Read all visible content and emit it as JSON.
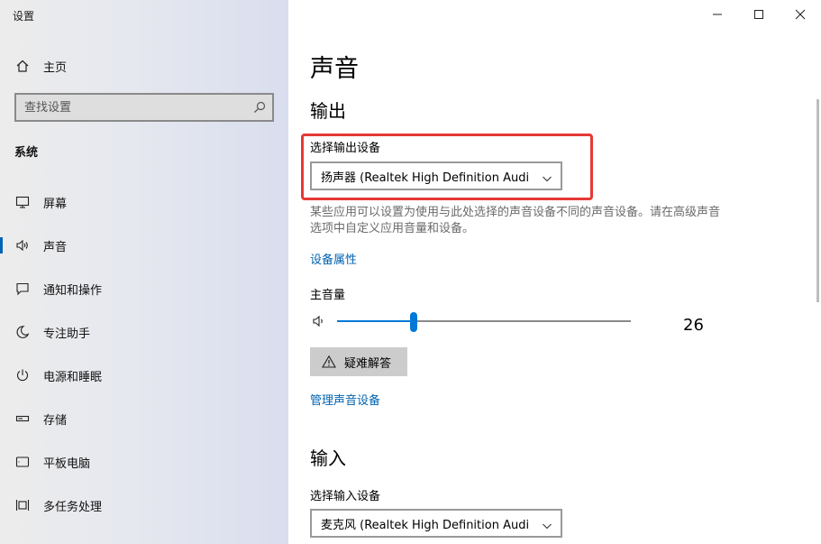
{
  "window": {
    "title": "设置",
    "controls": {
      "minimize": "minimize-icon",
      "maximize": "maximize-icon",
      "close": "close-icon"
    }
  },
  "sidebar": {
    "home_label": "主页",
    "search_placeholder": "查找设置",
    "section_label": "系统",
    "items": [
      {
        "label": "屏幕",
        "icon": "monitor-icon"
      },
      {
        "label": "声音",
        "icon": "speaker-icon",
        "selected": true
      },
      {
        "label": "通知和操作",
        "icon": "notification-icon"
      },
      {
        "label": "专注助手",
        "icon": "moon-icon"
      },
      {
        "label": "电源和睡眠",
        "icon": "power-icon"
      },
      {
        "label": "存储",
        "icon": "storage-icon"
      },
      {
        "label": "平板电脑",
        "icon": "tablet-icon"
      },
      {
        "label": "多任务处理",
        "icon": "multitask-icon"
      }
    ]
  },
  "main": {
    "page_title": "声音",
    "output": {
      "heading": "输出",
      "device_label": "选择输出设备",
      "device_value": "扬声器 (Realtek High Definition Audi...",
      "description": "某些应用可以设置为使用与此处选择的声音设备不同的声音设备。请在高级声音选项中自定义应用音量和设备。",
      "device_properties_link": "设备属性",
      "master_volume_label": "主音量",
      "volume_value": "26",
      "volume_fraction": 0.26,
      "troubleshoot_label": "疑难解答",
      "manage_devices_link": "管理声音设备"
    },
    "input": {
      "heading": "输入",
      "device_label": "选择输入设备",
      "device_value": "麦克风 (Realtek High Definition Audi..."
    }
  },
  "colors": {
    "accent": "#0078d7",
    "link": "#0063b1",
    "highlight": "#e53935"
  }
}
